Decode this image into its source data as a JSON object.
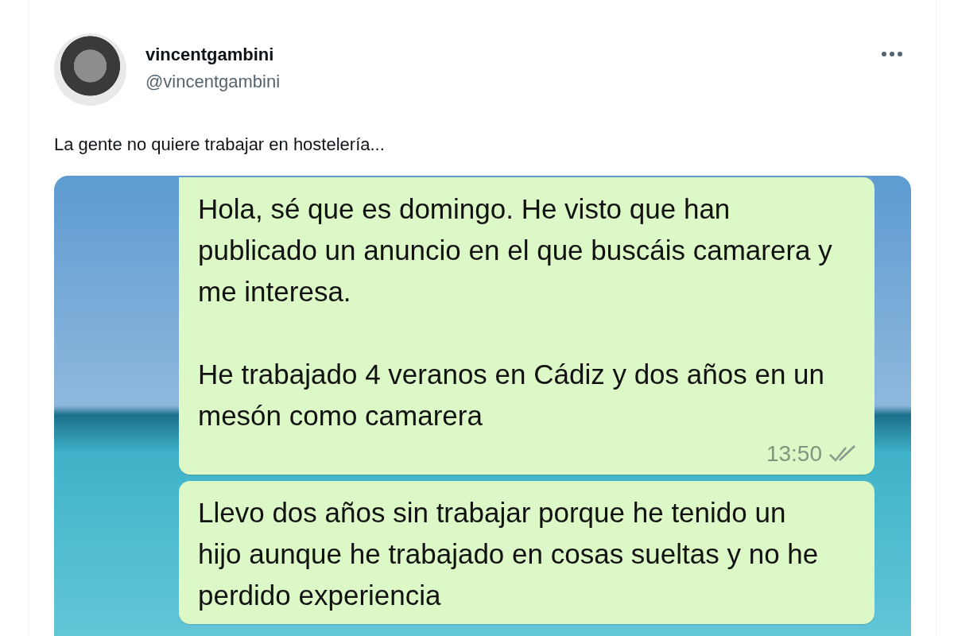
{
  "tweet": {
    "display_name": "vincentgambini",
    "handle": "@vincentgambini",
    "text": "La gente no quiere trabajar en hostelería...",
    "media": {
      "messages": [
        {
          "paragraphs": [
            "Hola, sé que es domingo. He visto que han publicado un anuncio en el que buscáis camarera y me interesa.",
            "He trabajado 4 veranos en Cádiz y dos años en un mesón como camarera"
          ],
          "time": "13:50"
        },
        {
          "paragraphs": [
            "Llevo dos años sin trabajar porque he tenido un hijo aunque he trabajado en cosas sueltas y no he perdido experiencia"
          ]
        }
      ]
    }
  }
}
